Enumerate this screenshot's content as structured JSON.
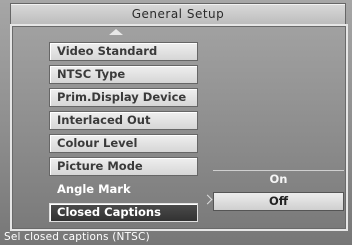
{
  "header": {
    "title": "General Setup"
  },
  "menu": {
    "items": [
      {
        "label": "Video Standard"
      },
      {
        "label": "NTSC Type"
      },
      {
        "label": "Prim.Display Device"
      },
      {
        "label": "Interlaced Out"
      },
      {
        "label": "Colour Level"
      },
      {
        "label": "Picture Mode"
      },
      {
        "label": "Angle Mark"
      },
      {
        "label": "Closed Captions"
      }
    ],
    "selected_index": 7
  },
  "options": {
    "items": [
      {
        "label": "On"
      },
      {
        "label": "Off"
      }
    ],
    "selected": "Off"
  },
  "status": {
    "text": "Sel closed captions (NTSC)"
  },
  "icons": {
    "scroll_up": "triangle-up",
    "submenu_arrow": "chevron-right"
  },
  "colors": {
    "highlight": "#3a3a3a",
    "button": "#d9d9d9"
  }
}
